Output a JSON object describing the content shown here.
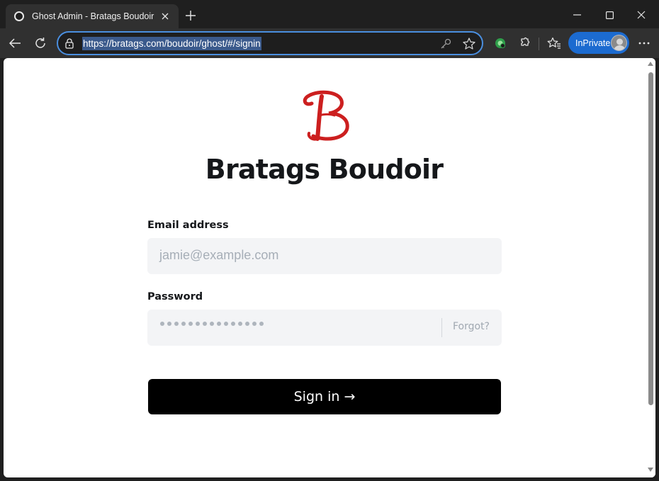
{
  "browser": {
    "tab_title": "Ghost Admin - Bratags Boudoir",
    "url": "https://bratags.com/boudoir/ghost/#/signin",
    "inprivate_label": "InPrivate",
    "colors": {
      "accent": "#4a8fe0",
      "inprivate": "#1c6bd0",
      "url_highlight": "#3b5a8c"
    }
  },
  "icons": {
    "favicon": "ghost-favicon-icon",
    "tab_close": "close-icon",
    "new_tab": "plus-icon",
    "minimize": "minimize-icon",
    "maximize": "maximize-icon",
    "close_window": "close-icon",
    "back": "back-arrow-icon",
    "refresh": "refresh-icon",
    "lock": "lock-icon",
    "password_key": "key-icon",
    "favorite": "star-icon",
    "extension_green": "extension-globe-icon",
    "extensions": "puzzle-icon",
    "favorites": "favorites-icon",
    "menu": "more-icon"
  },
  "page": {
    "site_title": "Bratags Boudoir",
    "logo_color": "#cc1f1f",
    "email": {
      "label": "Email address",
      "placeholder": "jamie@example.com"
    },
    "password": {
      "label": "Password",
      "masked_length": 15,
      "forgot": "Forgot?"
    },
    "signin_button": "Sign in →"
  }
}
